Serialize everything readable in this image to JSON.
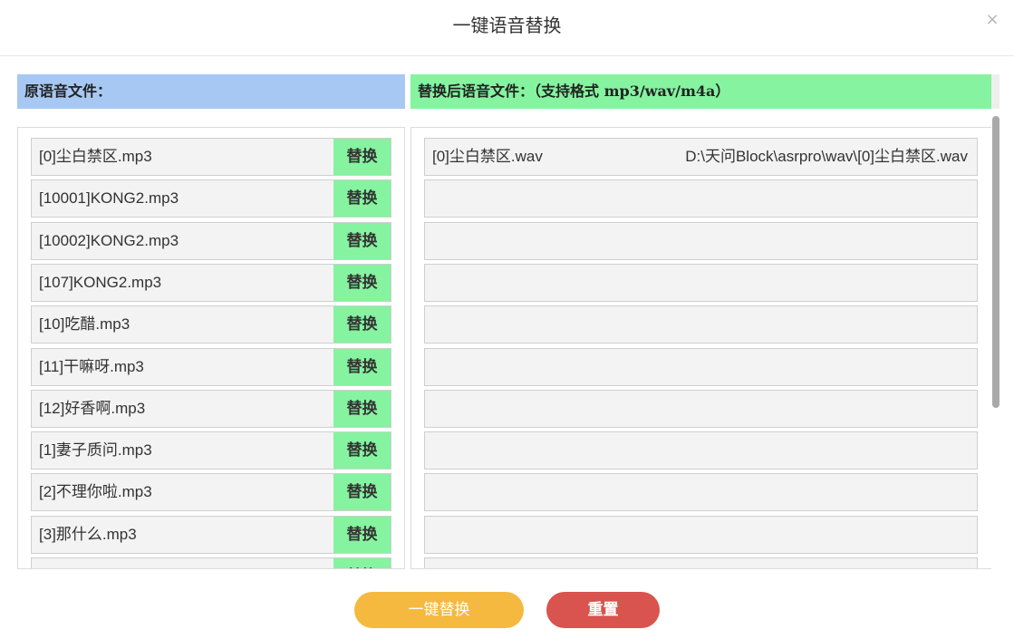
{
  "dialog": {
    "title": "一键语音替换",
    "close_icon": "close-icon",
    "close_glyph": "×"
  },
  "left": {
    "header": "原语音文件：",
    "items": [
      {
        "name": "[0]尘白禁区.mp3",
        "action": "替换"
      },
      {
        "name": "[10001]KONG2.mp3",
        "action": "替换"
      },
      {
        "name": "[10002]KONG2.mp3",
        "action": "替换"
      },
      {
        "name": "[107]KONG2.mp3",
        "action": "替换"
      },
      {
        "name": "[10]吃醋.mp3",
        "action": "替换"
      },
      {
        "name": "[11]干嘛呀.mp3",
        "action": "替换"
      },
      {
        "name": "[12]好香啊.mp3",
        "action": "替换"
      },
      {
        "name": "[1]妻子质问.mp3",
        "action": "替换"
      },
      {
        "name": "[2]不理你啦.mp3",
        "action": "替换"
      },
      {
        "name": "[3]那什么.mp3",
        "action": "替换"
      },
      {
        "name": "",
        "action": "替换"
      }
    ]
  },
  "right": {
    "header": "替换后语音文件：（支持格式 mp3/wav/m4a）",
    "items": [
      {
        "name": "[0]尘白禁区.wav",
        "path": "D:\\天问Block\\asrpro\\wav\\[0]尘白禁区.wav"
      },
      {
        "name": "",
        "path": ""
      },
      {
        "name": "",
        "path": ""
      },
      {
        "name": "",
        "path": ""
      },
      {
        "name": "",
        "path": ""
      },
      {
        "name": "",
        "path": ""
      },
      {
        "name": "",
        "path": ""
      },
      {
        "name": "",
        "path": ""
      },
      {
        "name": "",
        "path": ""
      },
      {
        "name": "",
        "path": ""
      },
      {
        "name": "",
        "path": ""
      }
    ]
  },
  "footer": {
    "replace_all": "一键替换",
    "reset": "重置"
  },
  "colors": {
    "left_header": "#a7c8f3",
    "right_header": "#85f39f",
    "replace_button": "#85f39f",
    "primary": "#f5b93f",
    "danger": "#d9534f"
  }
}
